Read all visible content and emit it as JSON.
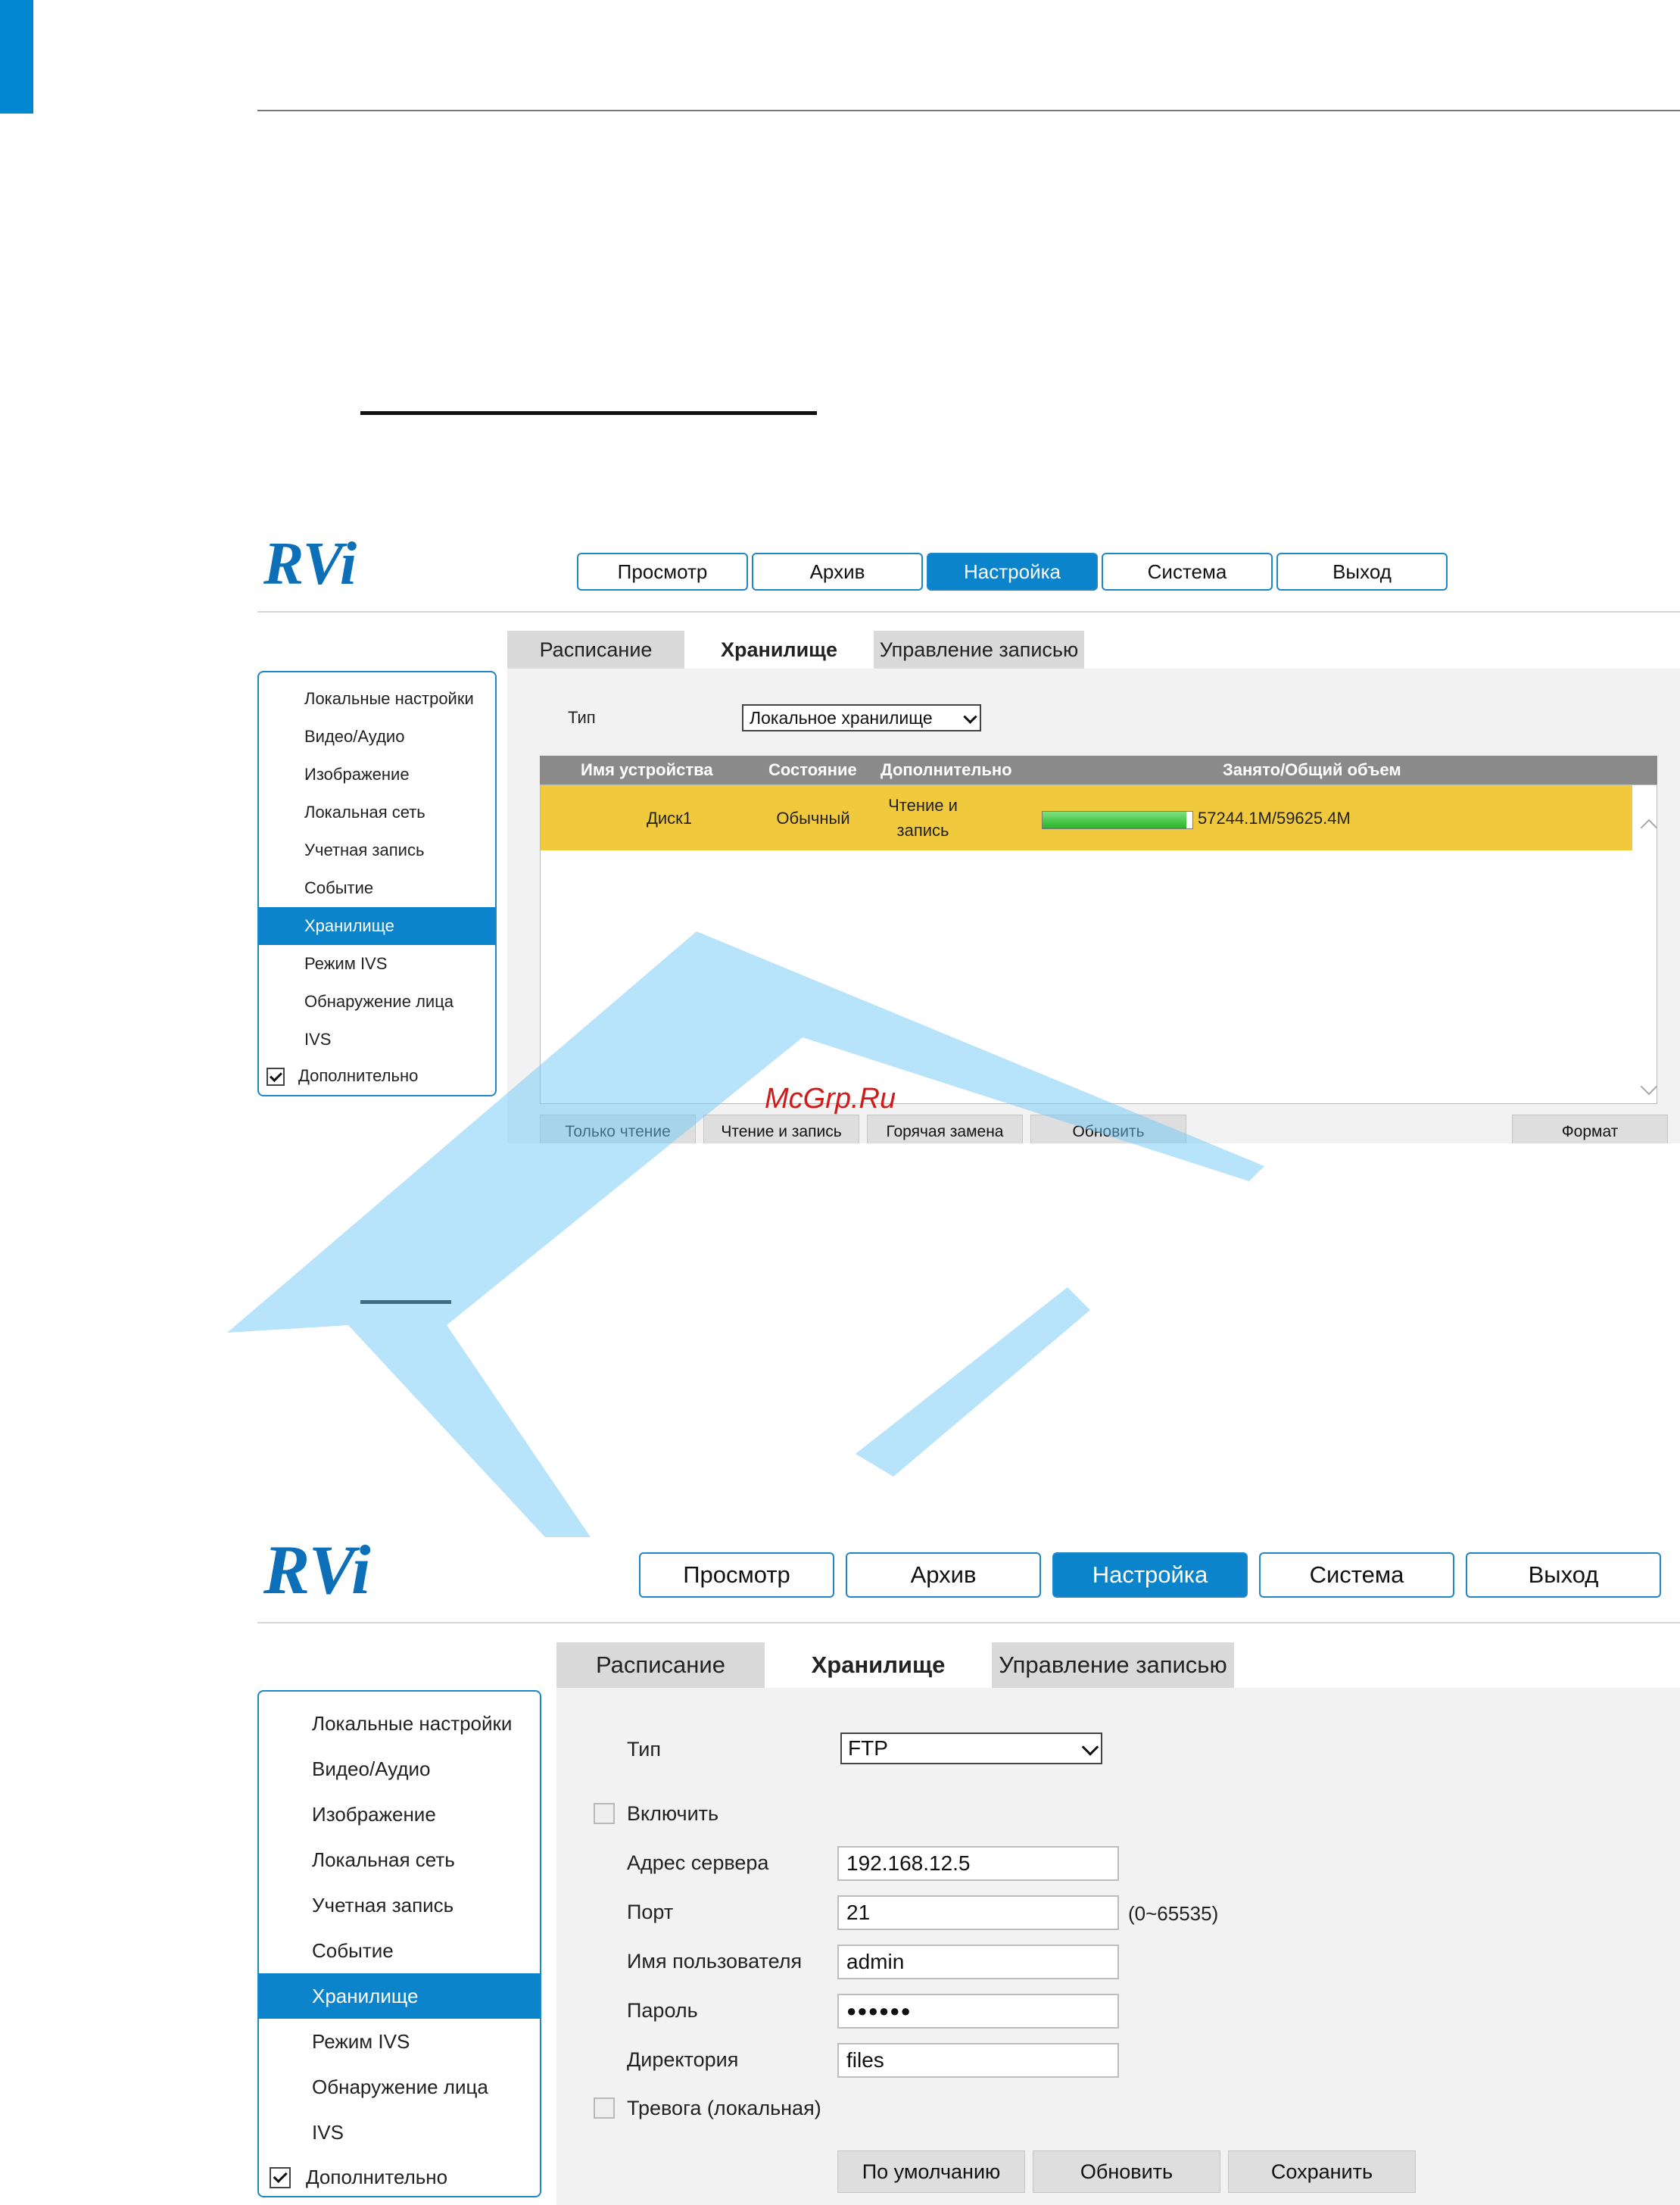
{
  "watermark": {
    "text": "McGrp.Ru"
  },
  "shared": {
    "logo": "RVi",
    "nav": [
      "Просмотр",
      "Архив",
      "Настройка",
      "Система",
      "Выход"
    ],
    "nav_active": "Настройка",
    "tabs": [
      "Расписание",
      "Хранилище",
      "Управление записью"
    ],
    "tab_active": "Хранилище",
    "sidebar": [
      "Локальные настройки",
      "Видео/Аудио",
      "Изображение",
      "Локальная сеть",
      "Учетная запись",
      "Событие",
      "Хранилище",
      "Режим IVS",
      "Обнаружение лица",
      "IVS"
    ],
    "sidebar_active": "Хранилище",
    "advanced_label": "Дополнительно",
    "advanced_checked": true
  },
  "local_panel": {
    "type_label": "Тип",
    "type_value": "Локальное хранилище",
    "table_headers": [
      "Имя устройства",
      "Состояние",
      "Дополнительно",
      "Занято/Общий объем"
    ],
    "rows": [
      {
        "name": "Диск1",
        "state": "Обычный",
        "extra_line1": "Чтение и",
        "extra_line2": "запись",
        "usage_text": "57244.1M/59625.4M",
        "used_mb": 57244.1,
        "total_mb": 59625.4
      }
    ],
    "buttons": [
      "Только чтение",
      "Чтение и запись",
      "Горячая замена",
      "Обновить"
    ],
    "format_button": "Формат"
  },
  "ftp_panel": {
    "type_label": "Тип",
    "type_value": "FTP",
    "enable_label": "Включить",
    "enable_checked": false,
    "fields": [
      {
        "label": "Адрес сервера",
        "value": "192.168.12.5"
      },
      {
        "label": "Порт",
        "value": "21",
        "hint": "(0~65535)"
      },
      {
        "label": "Имя пользователя",
        "value": "admin"
      },
      {
        "label": "Пароль",
        "value": "●●●●●●"
      },
      {
        "label": "Директория",
        "value": "files"
      }
    ],
    "alarm_label": "Тревога (локальная)",
    "alarm_checked": false,
    "buttons": [
      "По умолчанию",
      "Обновить",
      "Сохранить"
    ]
  }
}
